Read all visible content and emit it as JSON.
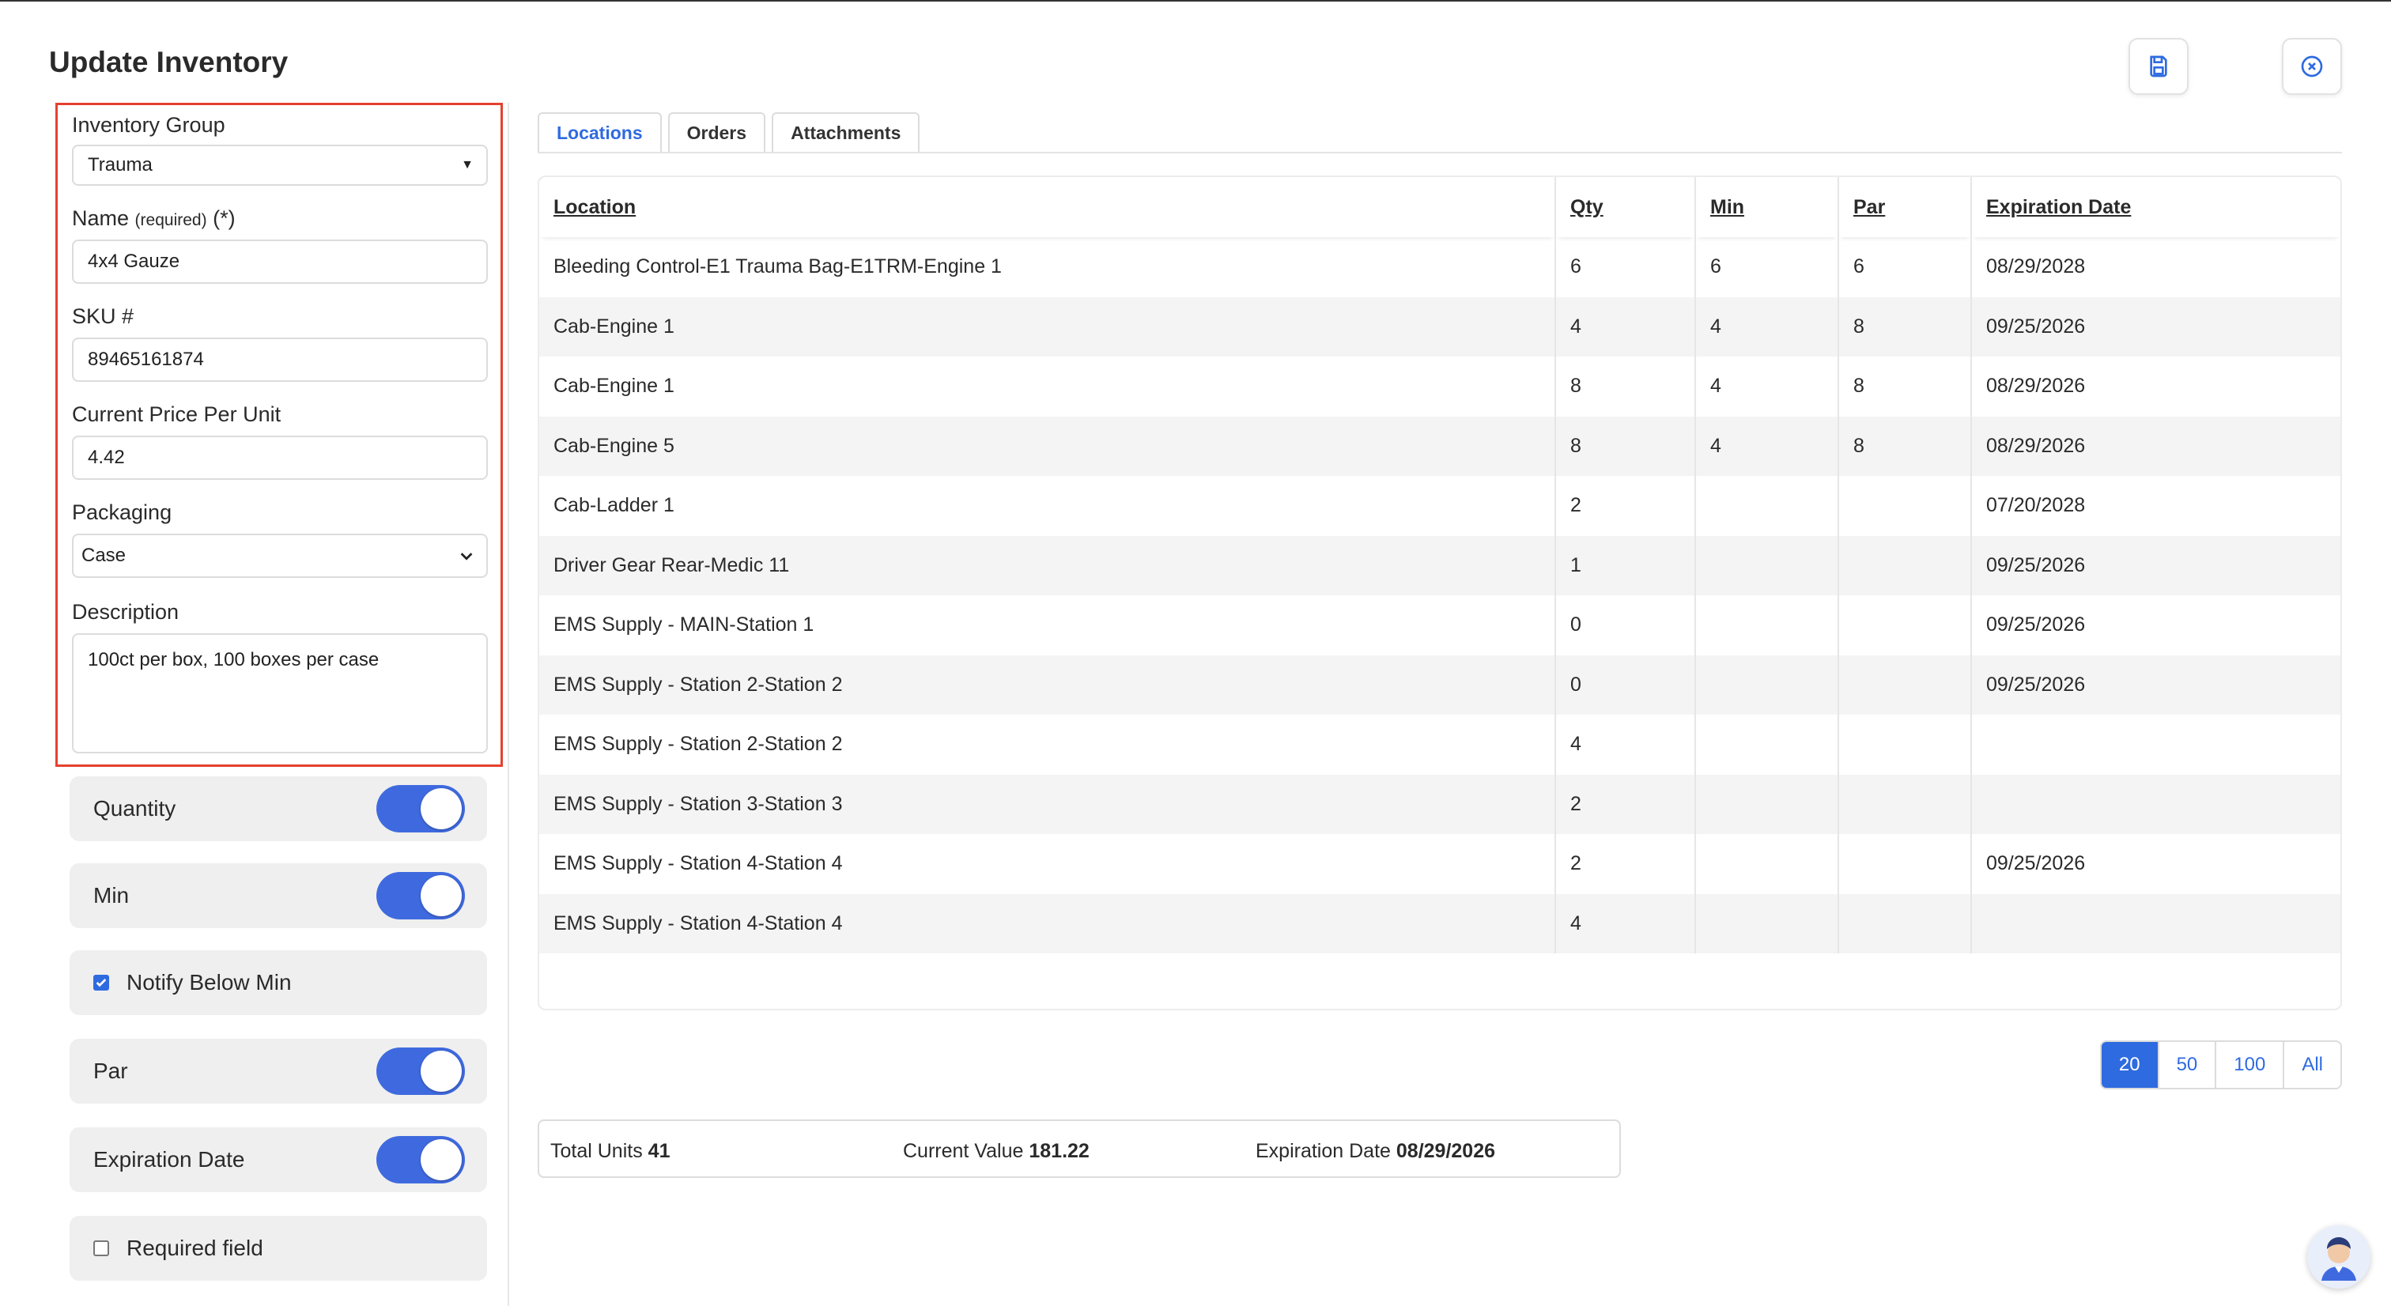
{
  "header": {
    "title": "Update Inventory"
  },
  "form": {
    "inventory_group": {
      "label": "Inventory Group",
      "value": "Trauma"
    },
    "name": {
      "label": "Name",
      "hint": "(required)",
      "required_mark": "(*)",
      "value": "4x4 Gauze"
    },
    "sku": {
      "label": "SKU #",
      "value": "89465161874"
    },
    "price": {
      "label": "Current Price Per Unit",
      "value": "4.42"
    },
    "packaging": {
      "label": "Packaging",
      "value": "Case"
    },
    "description": {
      "label": "Description",
      "value": "100ct per box, 100 boxes per case"
    }
  },
  "options": {
    "quantity": {
      "label": "Quantity",
      "enabled": true
    },
    "min": {
      "label": "Min",
      "enabled": true
    },
    "notify_below_min": {
      "label": "Notify Below Min",
      "checked": true
    },
    "par": {
      "label": "Par",
      "enabled": true
    },
    "expiration_date": {
      "label": "Expiration Date",
      "enabled": true
    },
    "required_field": {
      "label": "Required field",
      "checked": false
    }
  },
  "tabs": [
    {
      "label": "Locations",
      "active": true
    },
    {
      "label": "Orders",
      "active": false
    },
    {
      "label": "Attachments",
      "active": false
    }
  ],
  "table": {
    "columns": [
      "Location",
      "Qty",
      "Min",
      "Par",
      "Expiration Date"
    ],
    "rows": [
      [
        "Bleeding Control-E1 Trauma Bag-E1TRM-Engine 1",
        "6",
        "6",
        "6",
        "08/29/2028"
      ],
      [
        "Cab-Engine 1",
        "4",
        "4",
        "8",
        "09/25/2026"
      ],
      [
        "Cab-Engine 1",
        "8",
        "4",
        "8",
        "08/29/2026"
      ],
      [
        "Cab-Engine 5",
        "8",
        "4",
        "8",
        "08/29/2026"
      ],
      [
        "Cab-Ladder 1",
        "2",
        "",
        "",
        "07/20/2028"
      ],
      [
        "Driver Gear Rear-Medic 11",
        "1",
        "",
        "",
        "09/25/2026"
      ],
      [
        "EMS Supply - MAIN-Station 1",
        "0",
        "",
        "",
        "09/25/2026"
      ],
      [
        "EMS Supply - Station 2-Station 2",
        "0",
        "",
        "",
        "09/25/2026"
      ],
      [
        "EMS Supply - Station 2-Station 2",
        "4",
        "",
        "",
        ""
      ],
      [
        "EMS Supply - Station 3-Station 3",
        "2",
        "",
        "",
        ""
      ],
      [
        "EMS Supply - Station 4-Station 4",
        "2",
        "",
        "",
        "09/25/2026"
      ],
      [
        "EMS Supply - Station 4-Station 4",
        "4",
        "",
        "",
        ""
      ]
    ]
  },
  "pagination": {
    "options": [
      "20",
      "50",
      "100",
      "All"
    ],
    "selected": "20"
  },
  "summary": {
    "total_units_label": "Total Units",
    "total_units": "41",
    "current_value_label": "Current Value",
    "current_value": "181.22",
    "expiration_label": "Expiration Date",
    "expiration": "08/29/2026"
  },
  "colors": {
    "accent": "#2f6be0",
    "toggle": "#3f6adf",
    "highlight_border": "#e5412f"
  },
  "icons": {
    "save": "floppy-disk-icon",
    "close": "close-circle-icon",
    "avatar": "assistant-avatar-icon"
  }
}
